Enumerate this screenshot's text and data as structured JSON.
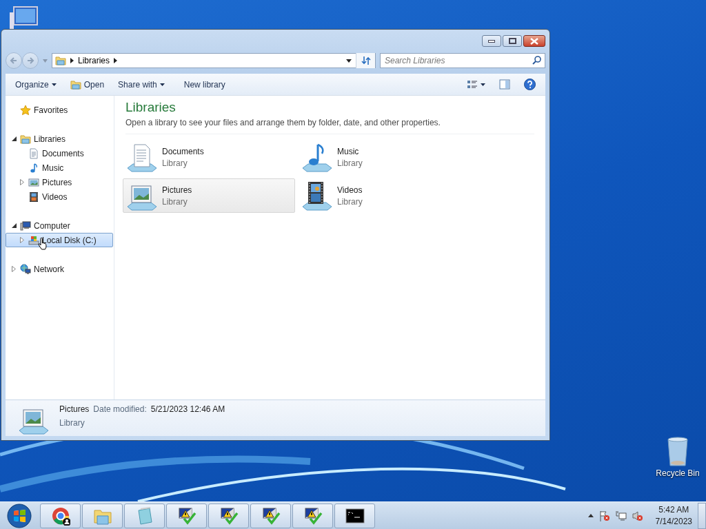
{
  "window": {
    "nav_buttons": [
      {
        "disabled": true
      },
      {
        "disabled": true
      }
    ],
    "address_path": [
      "Libraries"
    ],
    "search": {
      "placeholder": "Search Libraries"
    },
    "toolbar": [
      {
        "label": "Organize",
        "kind": "menu"
      },
      {
        "label": "Open",
        "kind": "icon"
      },
      {
        "label": "Share with",
        "kind": "menu"
      },
      {
        "label": "New library",
        "kind": "plain"
      }
    ],
    "nav_tree": [
      {
        "label": "Favorites",
        "kind": "leaf",
        "selected": false
      },
      {
        "label": "Libraries",
        "kind": "node",
        "expanded": true,
        "selected": false,
        "children": [
          {
            "label": "Documents",
            "kind": "leaf",
            "selected": false
          },
          {
            "label": "Music",
            "kind": "leaf",
            "selected": false
          },
          {
            "label": "Pictures",
            "kind": "node",
            "expanded": false,
            "selected": false
          },
          {
            "label": "Videos",
            "kind": "leaf",
            "selected": false
          }
        ]
      },
      {
        "label": "Computer",
        "kind": "node",
        "expanded": true,
        "selected": false,
        "children": [
          {
            "label": "Local Disk (C:)",
            "kind": "node",
            "expanded": false,
            "selected": true
          }
        ]
      },
      {
        "label": "Network",
        "kind": "node",
        "expanded": false,
        "selected": false
      }
    ],
    "content": {
      "title": "Libraries",
      "description": "Open a library to see your files and arrange them by folder, date, and other properties.",
      "items": [
        {
          "name": "Documents",
          "type": "Library",
          "selected": false
        },
        {
          "name": "Music",
          "type": "Library",
          "selected": false
        },
        {
          "name": "Pictures",
          "type": "Library",
          "selected": true
        },
        {
          "name": "Videos",
          "type": "Library",
          "selected": false
        }
      ]
    },
    "details": {
      "name": "Pictures",
      "date_label": "Date modified:",
      "date_value": "5/21/2023 12:46 AM",
      "type": "Library"
    }
  },
  "desktop_icons": [
    {
      "label": "Recycle Bin"
    }
  ],
  "tray": {
    "time": "5:42 AM",
    "date": "7/14/2023"
  }
}
